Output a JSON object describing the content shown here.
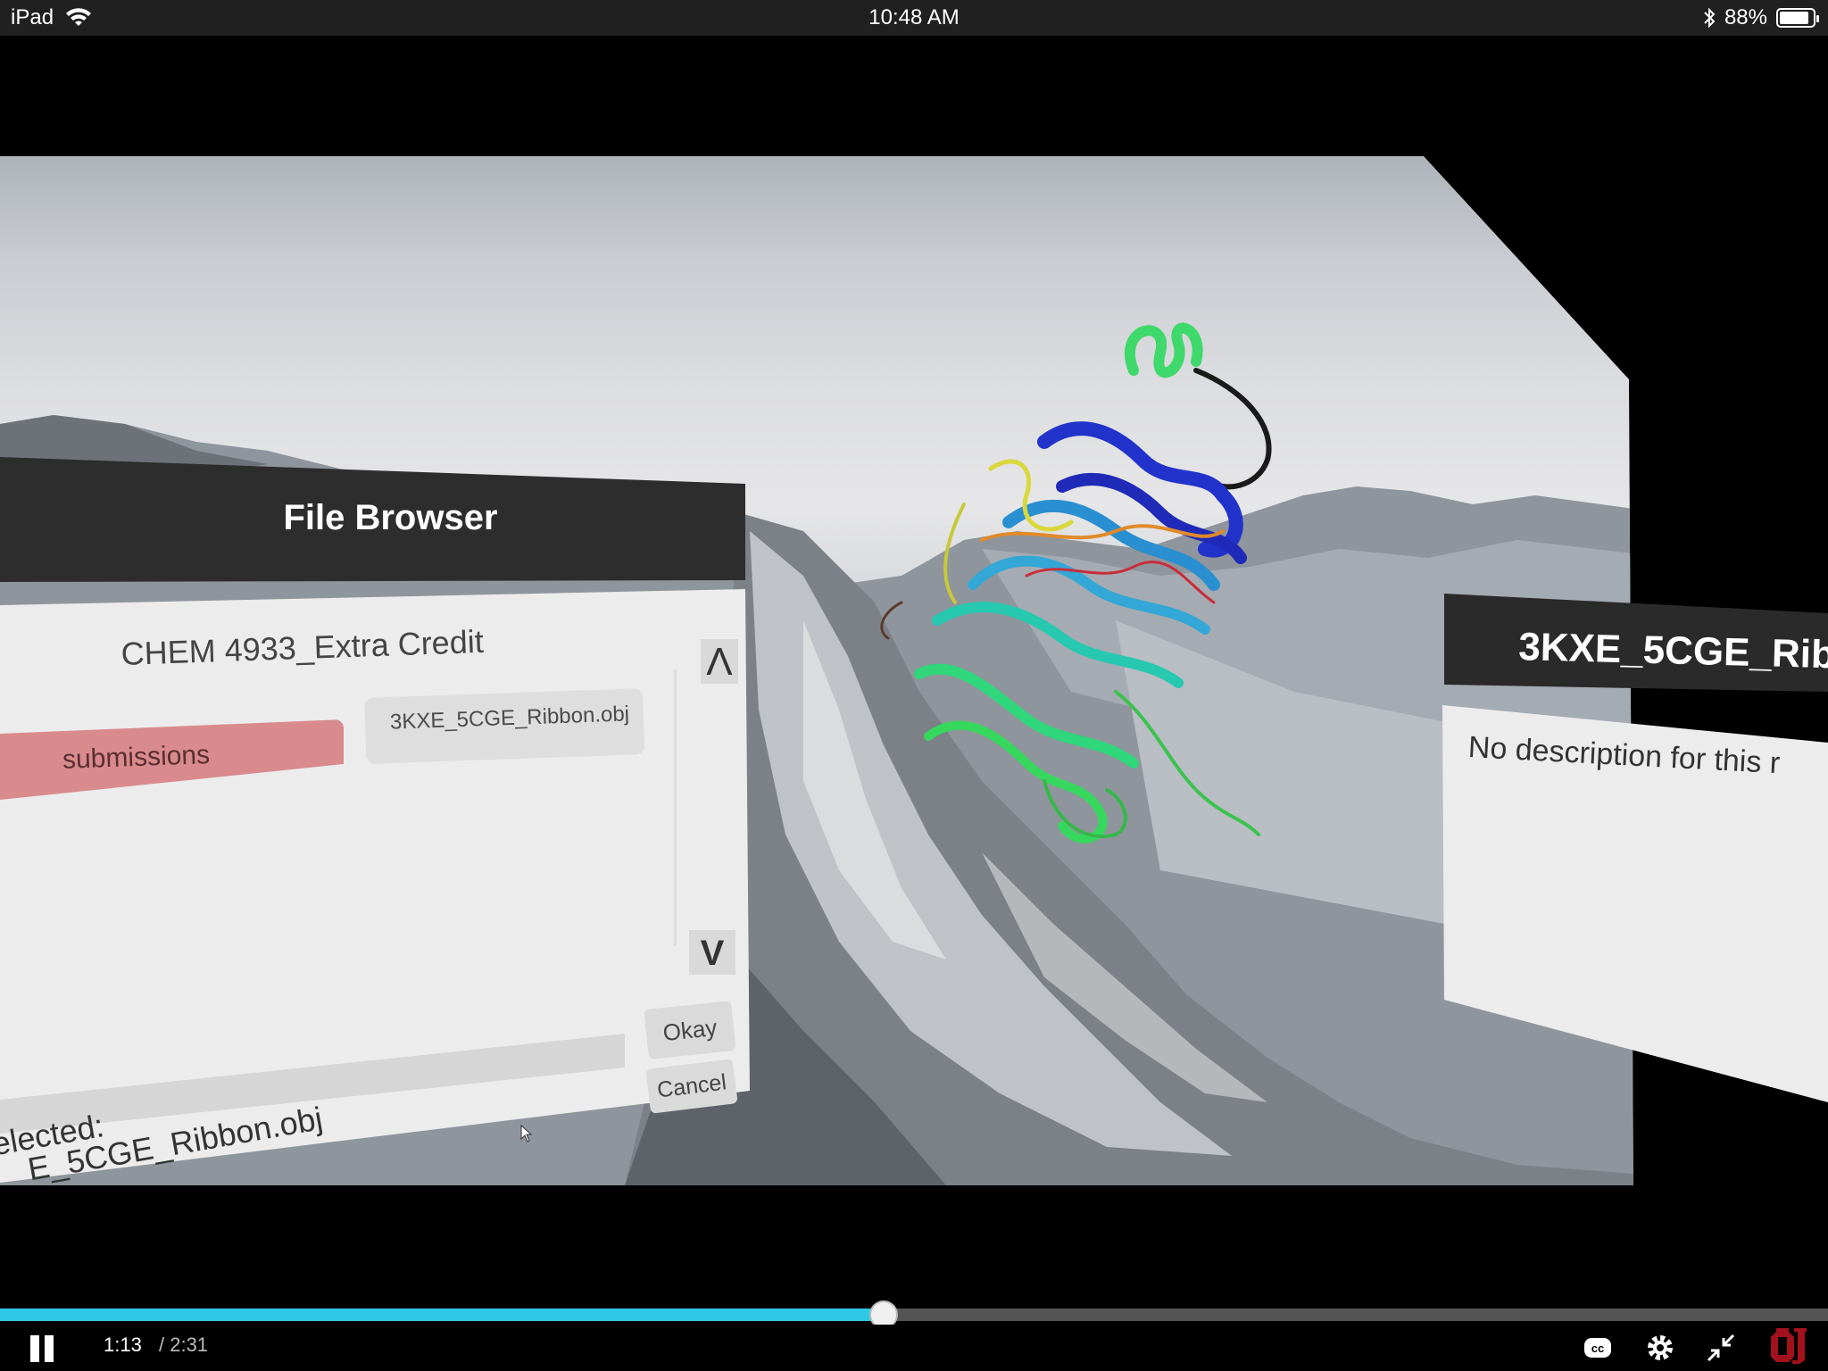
{
  "status_bar": {
    "device": "iPad",
    "time": "10:48 AM",
    "battery": "88%",
    "battery_level": 0.88
  },
  "file_browser": {
    "title": "File Browser",
    "folder": "CHEM 4933_Extra Credit",
    "scroll_up_label": "Λ",
    "scroll_down_label": "V",
    "items": [
      {
        "label": "submissions",
        "selected": true
      },
      {
        "label": "3KXE_5CGE_Ribbon.obj",
        "selected": false
      }
    ],
    "okay_label": "Okay",
    "cancel_label": "Cancel",
    "selected_label": "elected:",
    "selected_value": "E_5CGE_Ribbon.obj"
  },
  "model_panel": {
    "title": "3KXE_5CGE_Rib",
    "description": "No description for this r"
  },
  "player": {
    "current_time": "1:13",
    "duration": "/ 2:31",
    "progress": 0.4834
  },
  "colors": {
    "progress": "#2ec8e6",
    "selected_item": "#d98a8d",
    "panel_header": "#2d2d2d"
  }
}
